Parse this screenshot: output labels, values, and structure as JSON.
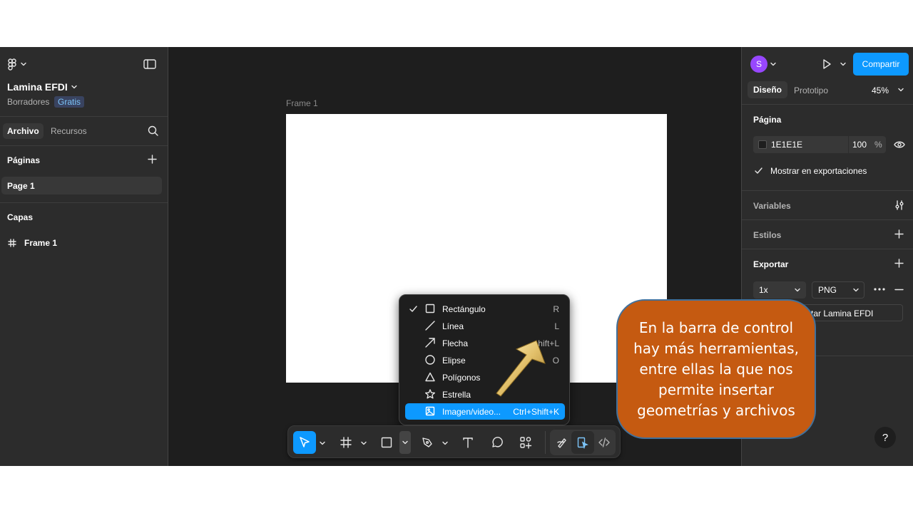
{
  "header": {
    "file_name": "Lamina EFDI",
    "location": "Borradores",
    "plan_badge": "Gratis"
  },
  "left_panel": {
    "tabs": [
      "Archivo",
      "Recursos"
    ],
    "pages_title": "Páginas",
    "pages": [
      "Page 1"
    ],
    "layers_title": "Capas",
    "layers": [
      "Frame 1"
    ]
  },
  "canvas": {
    "frame_label": "Frame 1"
  },
  "right_panel": {
    "avatar_letter": "S",
    "share_label": "Compartir",
    "tabs": [
      "Diseño",
      "Prototipo"
    ],
    "zoom": "45%",
    "page_section": "Página",
    "bg_color_hex": "1E1E1E",
    "bg_opacity": "100",
    "percent_sign": "%",
    "show_in_exports": "Mostrar en exportaciones",
    "variables": "Variables",
    "styles": "Estilos",
    "export_title": "Exportar",
    "export_scale": "1x",
    "export_format": "PNG",
    "export_button_partial": "tar Lamina EFDI",
    "help": "?"
  },
  "shape_menu": {
    "items": [
      {
        "label": "Rectángulo",
        "shortcut": "R",
        "checked": true
      },
      {
        "label": "Línea",
        "shortcut": "L"
      },
      {
        "label": "Flecha",
        "shortcut": "hift+L"
      },
      {
        "label": "Elipse",
        "shortcut": "O"
      },
      {
        "label": "Polígonos",
        "shortcut": ""
      },
      {
        "label": "Estrella",
        "shortcut": ""
      },
      {
        "label": "Imagen/video...",
        "shortcut": "Ctrl+Shift+K",
        "highlighted": true
      }
    ]
  },
  "callout": {
    "text": "En la barra de control hay más herramientas, entre ellas la que nos permite insertar geometrías y archivos"
  },
  "colors": {
    "accent": "#0d99ff",
    "callout_fill": "#c55a11",
    "canvas_bg": "#1e1e1e",
    "panel_bg": "#2c2c2c"
  }
}
